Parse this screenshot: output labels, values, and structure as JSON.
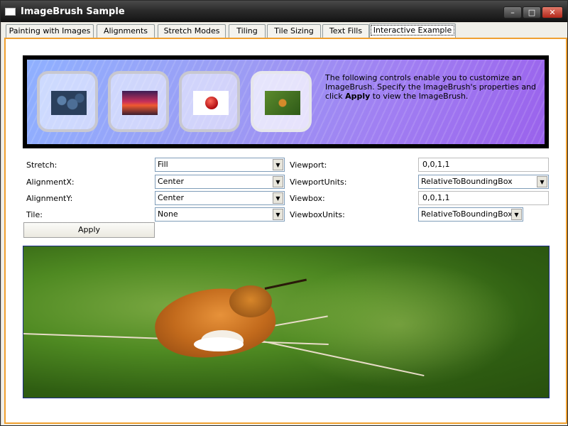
{
  "window": {
    "title": "ImageBrush Sample",
    "buttons": {
      "minimize": "–",
      "maximize": "□",
      "close": "✕"
    }
  },
  "tabs": [
    {
      "label": "Painting with Images",
      "active": false
    },
    {
      "label": "Alignments",
      "active": false
    },
    {
      "label": "Stretch Modes",
      "active": false
    },
    {
      "label": "Tiling",
      "active": false
    },
    {
      "label": "Tile Sizing",
      "active": false
    },
    {
      "label": "Text Fills",
      "active": false
    },
    {
      "label": "Interactive Example",
      "active": true
    }
  ],
  "banner": {
    "thumbnails": [
      {
        "name": "berries",
        "selected": false
      },
      {
        "name": "sunset",
        "selected": false
      },
      {
        "name": "apple",
        "selected": false
      },
      {
        "name": "hummingbird",
        "selected": true
      }
    ],
    "text_before": "The following controls enable you to customize an ImageBrush. Specify the ImageBrush's properties and click ",
    "text_bold": "Apply",
    "text_after": " to view the ImageBrush."
  },
  "form": {
    "stretch": {
      "label": "Stretch:",
      "value": "Fill"
    },
    "alignment_x": {
      "label": "AlignmentX:",
      "value": "Center"
    },
    "alignment_y": {
      "label": "AlignmentY:",
      "value": "Center"
    },
    "tile": {
      "label": "Tile:",
      "value": "None"
    },
    "viewport": {
      "label": "Viewport:",
      "value": "0,0,1,1"
    },
    "viewport_units": {
      "label": "ViewportUnits:",
      "value": "RelativeToBoundingBox"
    },
    "viewbox": {
      "label": "Viewbox:",
      "value": "0,0,1,1"
    },
    "viewbox_units": {
      "label": "ViewboxUnits:",
      "value": "RelativeToBoundingBox"
    },
    "apply_label": "Apply"
  },
  "colors": {
    "tab_page_border": "#f0a030",
    "preview_border": "#1a2a8a"
  }
}
